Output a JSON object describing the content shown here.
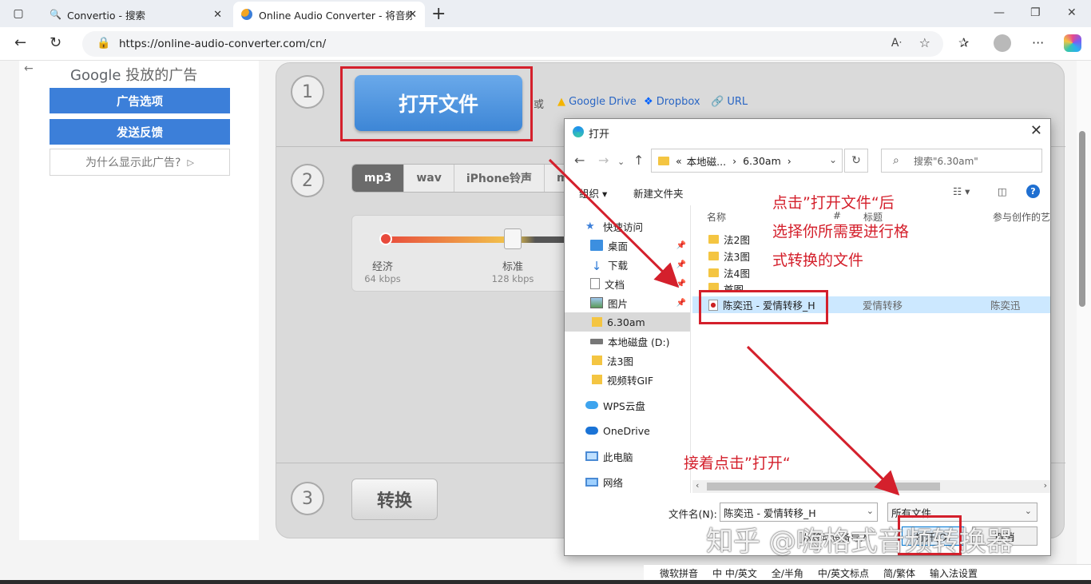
{
  "browser": {
    "tabs": [
      {
        "label": "Convertio - 搜索",
        "close": "✕",
        "active": false
      },
      {
        "label": "Online Audio Converter - 将音频文",
        "close": "✕",
        "active": true
      }
    ],
    "url": "https://online-audio-converter.com/cn/"
  },
  "ads": {
    "back_glyph": "←",
    "brand": "Google",
    "header": "投放的广告",
    "options_label": "广告选项",
    "feedback_label": "发送反馈",
    "why_label": "为什么显示此广告?"
  },
  "converter": {
    "steps": [
      "1",
      "2",
      "3"
    ],
    "open_button": "打开文件",
    "or_label": "或",
    "sources": [
      "Google Drive",
      "Dropbox",
      "URL"
    ],
    "formats": [
      "mp3",
      "wav",
      "iPhone铃声",
      "m"
    ],
    "selected_format": "mp3",
    "quality": [
      {
        "label": "经济",
        "sub": "64 kbps"
      },
      {
        "label": "标准",
        "sub": "128 kbps"
      }
    ],
    "convert_button": "转换"
  },
  "dialog": {
    "title": "打开",
    "path": [
      "«",
      "本地磁...",
      "›",
      "6.30am",
      "›"
    ],
    "search_placeholder": "搜索\"6.30am\"",
    "toolbar": {
      "organize": "组织 ▾",
      "new_folder": "新建文件夹"
    },
    "nav_items": [
      {
        "label": "快速访问",
        "icon": "star-icon"
      },
      {
        "label": "桌面",
        "icon": "desktop-icon"
      },
      {
        "label": "下载",
        "icon": "download-icon"
      },
      {
        "label": "文档",
        "icon": "document-icon"
      },
      {
        "label": "图片",
        "icon": "picture-icon"
      },
      {
        "label": "6.30am",
        "icon": "folder-icon"
      },
      {
        "label": "本地磁盘 (D:)",
        "icon": "drive-icon"
      },
      {
        "label": "法3图",
        "icon": "folder-icon"
      },
      {
        "label": "视频转GIF",
        "icon": "folder-icon"
      },
      {
        "label": "WPS云盘",
        "icon": "cloud-icon"
      },
      {
        "label": "OneDrive",
        "icon": "cloud-icon"
      },
      {
        "label": "此电脑",
        "icon": "computer-icon"
      },
      {
        "label": "网络",
        "icon": "network-icon"
      }
    ],
    "columns": [
      "名称",
      "#",
      "标题",
      "参与创作的艺"
    ],
    "files": [
      {
        "name": "法2图",
        "title": "",
        "artist": ""
      },
      {
        "name": "法3图",
        "title": "",
        "artist": ""
      },
      {
        "name": "法4图",
        "title": "",
        "artist": ""
      },
      {
        "name": "首图",
        "title": "",
        "artist": ""
      },
      {
        "name": "陈奕迅 - 爱情转移_H",
        "title": "爱情转移",
        "artist": "陈奕迅"
      }
    ],
    "filename_label": "文件名(N):",
    "filename_value": "陈奕迅 - 爱情转移_H",
    "filetype_value": "所有文件",
    "open_label": "打开(O)",
    "cancel_label": "取消",
    "extract_label": "从移动设备导入"
  },
  "annotations": {
    "note1": [
      "点击”打开文件“后",
      "选择你所需要进行格",
      "式转换的文件"
    ],
    "note2": "接着点击”打开“"
  },
  "watermark": "知乎 @嗨格式音频转换器",
  "ime": [
    "中 中/英文",
    "全/半角",
    "中/英文标点",
    "简/繁体",
    "输入法设置",
    "微软拼音"
  ],
  "colors": {
    "accent": "#3c7fd9",
    "annotation": "#d4202c"
  }
}
